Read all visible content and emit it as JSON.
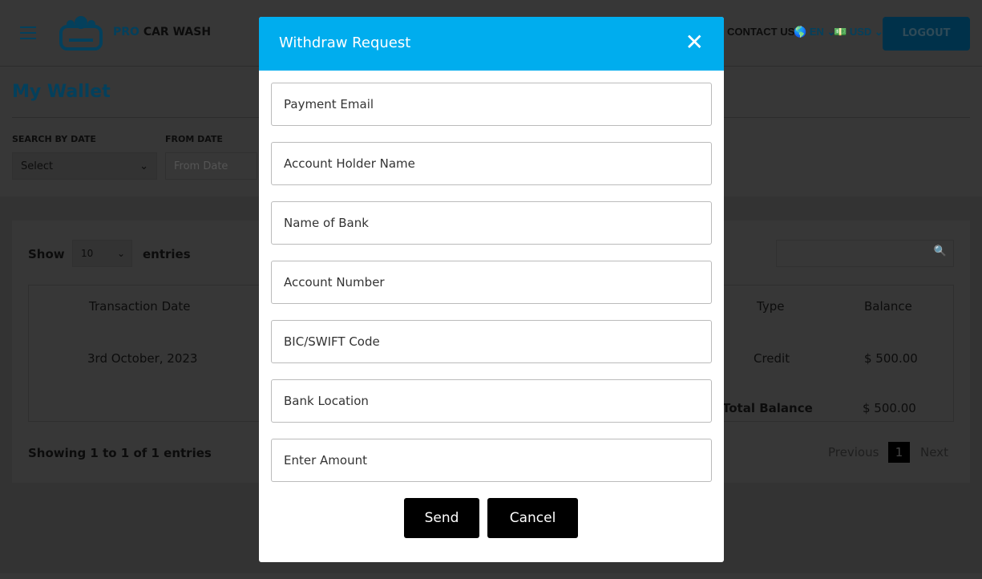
{
  "header": {
    "brand_pro": "PRO",
    "brand_rest": " CAR WASH",
    "contact": "CONTACT US",
    "language": "EN",
    "currency": "USD",
    "logout": "LOGOUT"
  },
  "page": {
    "title": "My Wallet",
    "search_by_date_label": "SEARCH BY DATE",
    "search_by_date_value": "Select",
    "from_date_label": "FROM DATE",
    "from_date_placeholder": "From Date"
  },
  "table": {
    "show": "Show",
    "entries_value": "10",
    "entries": "entries",
    "columns": [
      "Transaction Date",
      "Type",
      "Balance"
    ],
    "rows": [
      {
        "date": "3rd October, 2023",
        "type": "Credit",
        "balance": "$ 500.00"
      }
    ],
    "total_label": "Total Balance",
    "total_value": "$ 500.00",
    "info": "Showing 1 to 1 of 1 entries",
    "previous": "Previous",
    "page": "1",
    "next": "Next"
  },
  "modal": {
    "title": "Withdraw Request",
    "fields": [
      "Payment Email",
      "Account Holder Name",
      "Name of Bank",
      "Account Number",
      "BIC/SWIFT Code",
      "Bank Location",
      "Enter Amount"
    ],
    "send": "Send",
    "cancel": "Cancel"
  },
  "colors": {
    "accent": "#00adee",
    "brand": "#0a8fc9"
  }
}
